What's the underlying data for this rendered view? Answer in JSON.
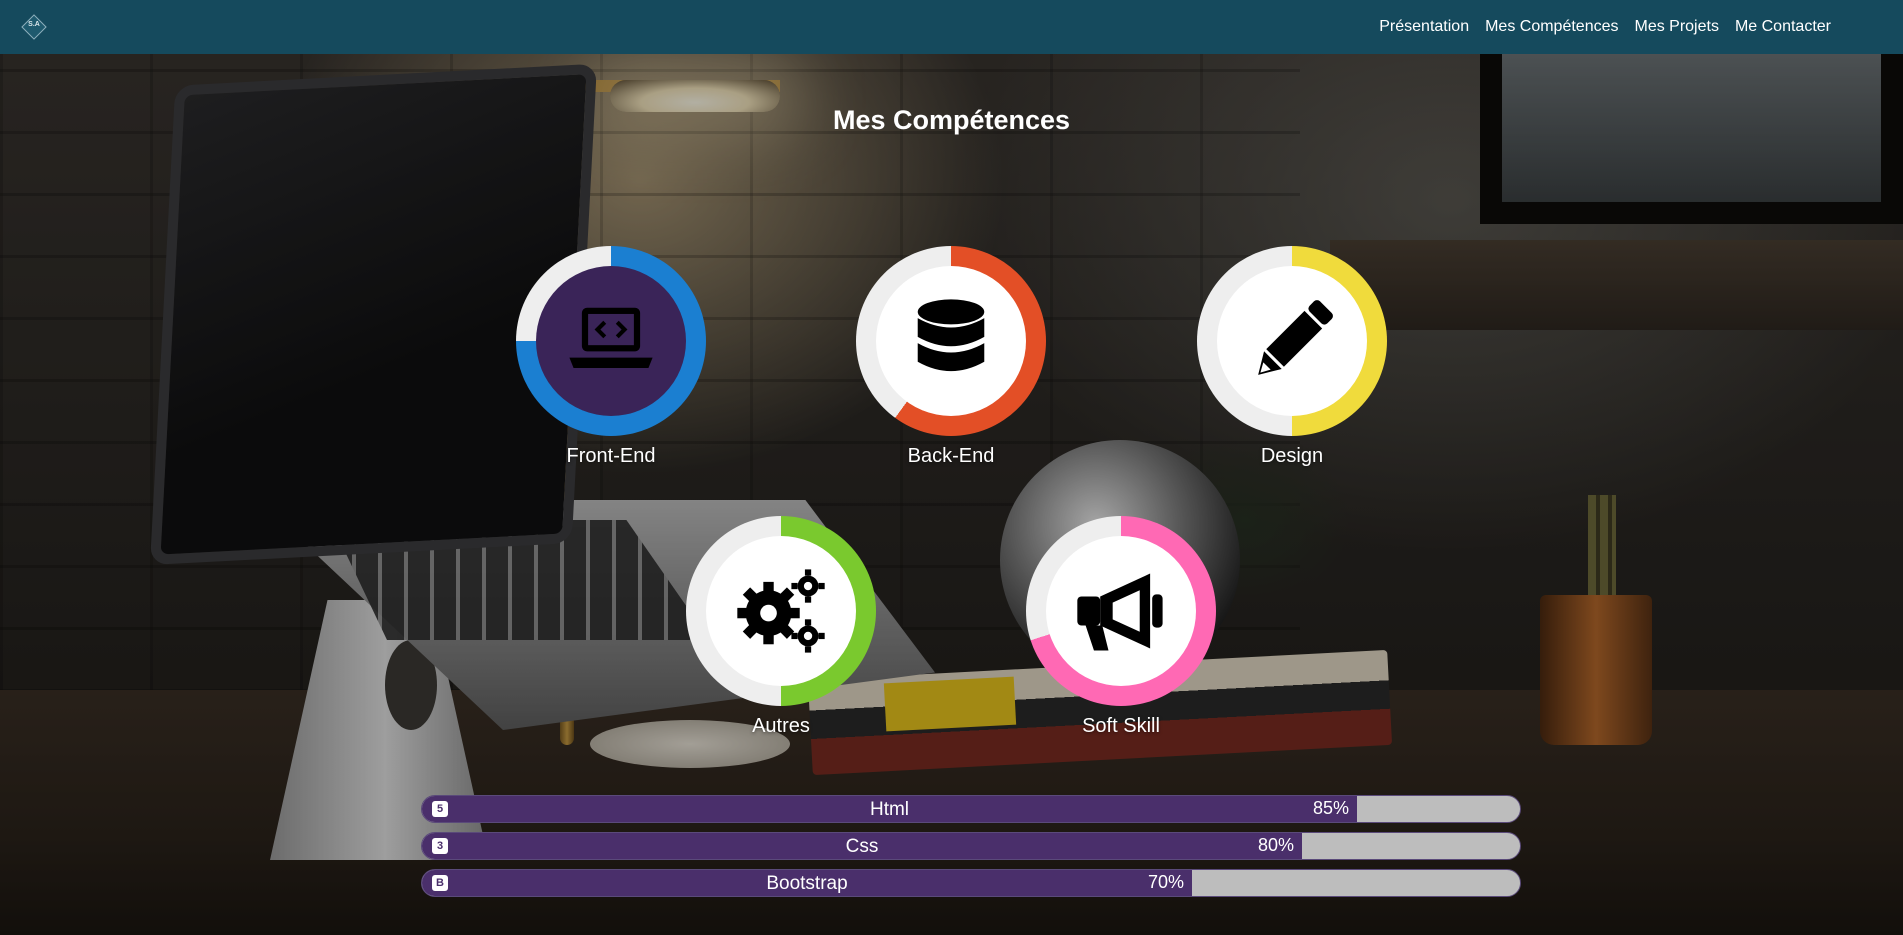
{
  "navbar": {
    "logo_text": "S.A",
    "links": [
      "Présentation",
      "Mes Compétences",
      "Mes Projets",
      "Me Contacter"
    ]
  },
  "page_title": "Mes Compétences",
  "skills": [
    {
      "label": "Front-End",
      "icon": "laptop-code-icon",
      "percent": 75,
      "ring_color": "#1b7fd1",
      "inner_bg": "#3a2458",
      "icon_color": "#000000"
    },
    {
      "label": "Back-End",
      "icon": "database-icon",
      "percent": 60,
      "ring_color": "#e34f26",
      "inner_bg": "#ffffff",
      "icon_color": "#000000"
    },
    {
      "label": "Design",
      "icon": "pencil-icon",
      "percent": 50,
      "ring_color": "#f0db3c",
      "inner_bg": "#ffffff",
      "icon_color": "#000000"
    },
    {
      "label": "Autres",
      "icon": "gears-icon",
      "percent": 50,
      "ring_color": "#7ac92e",
      "inner_bg": "#ffffff",
      "icon_color": "#000000"
    },
    {
      "label": "Soft Skill",
      "icon": "megaphone-icon",
      "percent": 70,
      "ring_color": "#ff69b4",
      "inner_bg": "#ffffff",
      "icon_color": "#000000"
    }
  ],
  "bars": [
    {
      "name": "Html",
      "percent": 85,
      "percent_label": "85%",
      "icon": "html5-icon"
    },
    {
      "name": "Css",
      "percent": 80,
      "percent_label": "80%",
      "icon": "css3-icon"
    },
    {
      "name": "Bootstrap",
      "percent": 70,
      "percent_label": "70%",
      "icon": "bootstrap-icon"
    }
  ],
  "colors": {
    "navbar": "#154a5d",
    "bar_fill": "#4a2f6b",
    "bar_track": "#bdbdbd",
    "ring_track": "#eeeeee"
  }
}
